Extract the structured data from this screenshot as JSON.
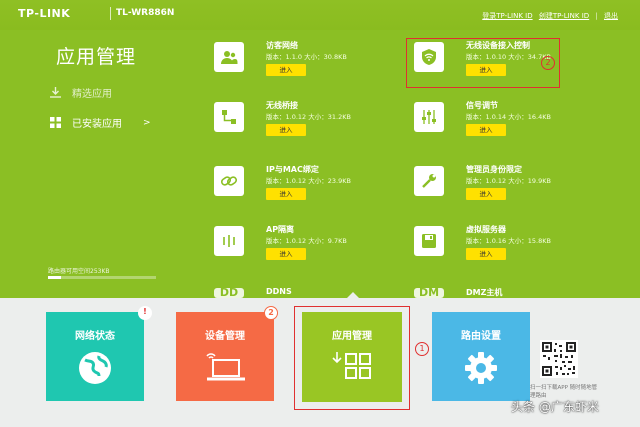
{
  "header": {
    "brand": "TP-LINK",
    "model": "TL-WR886N",
    "links": [
      "登录TP-LINK ID",
      "创建TP-LINK ID",
      "|",
      "退出"
    ]
  },
  "sidebar": {
    "title": "应用管理",
    "items": [
      {
        "label": "精选应用",
        "icon": "download-icon"
      },
      {
        "label": "已安装应用",
        "icon": "grid-icon"
      }
    ],
    "arrow": ">",
    "storage_text": "路由器可用空间253KB",
    "storage_used_fraction": 0.12
  },
  "apps": [
    {
      "name": "访客网络",
      "meta": "版本：1.1.0 大小：30.8KB",
      "button": "进入",
      "icon": "guest-icon"
    },
    {
      "name": "无线设备接入控制",
      "meta": "版本：1.0.10 大小：34.7KB",
      "button": "进入",
      "icon": "wifi-shield-icon"
    },
    {
      "name": "无线桥接",
      "meta": "版本：1.0.12 大小：31.2KB",
      "button": "进入",
      "icon": "bridge-icon"
    },
    {
      "name": "信号调节",
      "meta": "版本：1.0.14 大小：16.4KB",
      "button": "进入",
      "icon": "sliders-icon"
    },
    {
      "name": "IP与MAC绑定",
      "meta": "版本：1.0.12 大小：23.9KB",
      "button": "进入",
      "icon": "link-icon"
    },
    {
      "name": "管理员身份限定",
      "meta": "版本：1.0.12 大小：19.9KB",
      "button": "进入",
      "icon": "wrench-icon"
    },
    {
      "name": "AP隔离",
      "meta": "版本：1.0.12 大小：9.7KB",
      "button": "进入",
      "icon": "isolation-icon"
    },
    {
      "name": "虚拟服务器",
      "meta": "版本：1.0.16 大小：15.8KB",
      "button": "进入",
      "icon": "server-icon"
    },
    {
      "name": "DDNS",
      "abbr": "DD",
      "icon": "ddns-icon"
    },
    {
      "name": "DMZ主机",
      "abbr": "DM",
      "icon": "dmz-icon"
    }
  ],
  "annotations": {
    "app_highlight_number": "2",
    "tile_highlight_number": "1"
  },
  "tiles": [
    {
      "label": "网络状态",
      "color": "#1fc7b0",
      "badge": "!",
      "badge_color": "#e03030",
      "icon": "globe-icon"
    },
    {
      "label": "设备管理",
      "color": "#f56a45",
      "badge": "2",
      "badge_color": "#f56a45",
      "icon": "laptop-icon"
    },
    {
      "label": "应用管理",
      "color": "#99c624",
      "icon": "apps-grid-icon"
    },
    {
      "label": "路由设置",
      "color": "#4bb8e6",
      "icon": "gear-icon"
    }
  ],
  "qr_caption": "扫一扫下载APP 随时随地管理路由",
  "watermark": "头条 @广东虾米",
  "colors": {
    "main_green": "#8bbf24",
    "enter_yellow": "#ffe100",
    "annotation_red": "#e03030"
  }
}
